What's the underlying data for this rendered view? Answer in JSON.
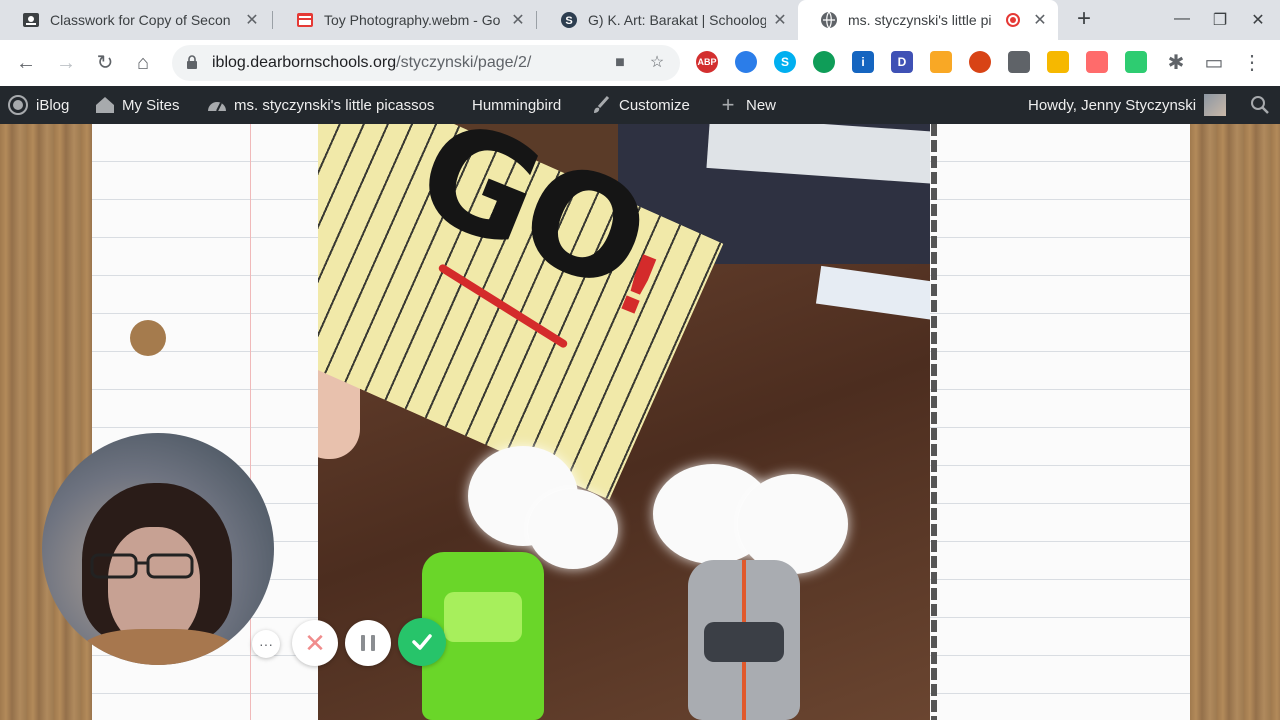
{
  "tabs": [
    {
      "title": "Classwork for Copy of Secon",
      "favicon": "classroom-icon",
      "active": false
    },
    {
      "title": "Toy Photography.webm - Go",
      "favicon": "video-file-icon",
      "active": false
    },
    {
      "title": "G) K. Art: Barakat | Schoolog",
      "favicon": "schoology-icon",
      "active": false
    },
    {
      "title": "ms. styczynski's little pi",
      "favicon": "globe-icon",
      "active": true,
      "recording": true
    }
  ],
  "address_bar": {
    "domain": "iblog.dearbornschools.org",
    "path": "/styczynski/page/2/"
  },
  "extensions": [
    {
      "name": "adblock-icon",
      "label": "ABP",
      "color": "#d32f2f"
    },
    {
      "name": "compass-extension-icon",
      "label": "",
      "color": "#2b7de9"
    },
    {
      "name": "skype-icon",
      "label": "S",
      "color": "#00aff0"
    },
    {
      "name": "speech-bubble-extension-icon",
      "label": "",
      "color": "#0f9d58"
    },
    {
      "name": "info-extension-icon",
      "label": "i",
      "color": "#1565c0"
    },
    {
      "name": "d-extension-icon",
      "label": "D",
      "color": "#3f51b5"
    },
    {
      "name": "folder-extension-icon",
      "label": "",
      "color": "#f9a825"
    },
    {
      "name": "spiral-extension-icon",
      "label": "",
      "color": "#d84315"
    },
    {
      "name": "grid-extension-icon",
      "label": "",
      "color": "#5f6368"
    },
    {
      "name": "thumbs-up-extension-icon",
      "label": "",
      "color": "#f6b800"
    },
    {
      "name": "screencastify-icon",
      "label": "",
      "color": "#ff6b6b"
    },
    {
      "name": "bitmoji-extension-icon",
      "label": "",
      "color": "#2ecc71"
    }
  ],
  "admin_bar": {
    "wp_label": "iBlog",
    "my_sites": "My Sites",
    "site_name": "ms. styczynski's little picassos",
    "theme": "Hummingbird",
    "customize": "Customize",
    "new": "New",
    "howdy": "Howdy, Jenny Styczynski"
  },
  "video_sign": {
    "text": "GO",
    "exclaim": "!"
  },
  "recorder_controls": {
    "more": "···",
    "cancel": "✕"
  },
  "colors": {
    "adminbar_bg": "#23282d",
    "record_red": "#e53935",
    "done_green": "#27c46a"
  }
}
